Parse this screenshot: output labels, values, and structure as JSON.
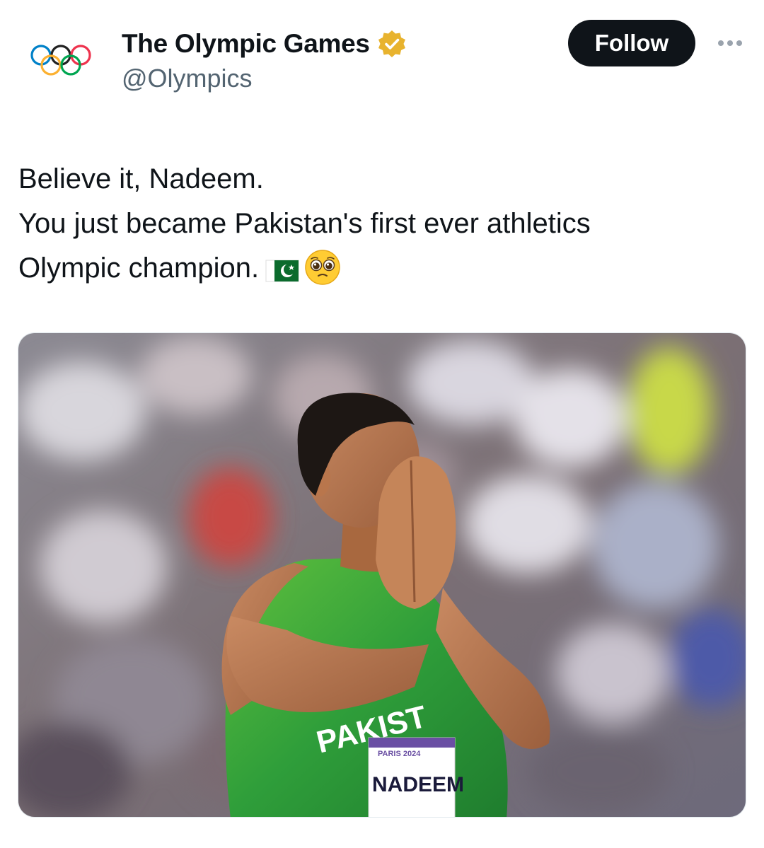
{
  "author": {
    "display_name": "The Olympic Games",
    "handle": "@Olympics",
    "verified_badge": "gold-verified-icon",
    "avatar": "olympic-rings-logo"
  },
  "actions": {
    "follow_label": "Follow",
    "more_icon": "more-options-icon"
  },
  "tweet": {
    "lines": [
      "Believe it, Nadeem.",
      "You just became Pakistan's first ever athletics",
      "Olympic champion."
    ],
    "emojis": [
      "pakistan-flag-emoji",
      "pleading-face-emoji"
    ]
  },
  "media": {
    "description": "Athlete in green Pakistan vest with hands pressed together over face",
    "jersey_text": "PAKIST",
    "bib_event": "PARIS 2024",
    "bib_name": "NADEEM"
  },
  "colors": {
    "follow_bg": "#0f1419",
    "handle": "#536471",
    "verified": "#e8b32e",
    "jersey_green": "#2f9e3a"
  }
}
